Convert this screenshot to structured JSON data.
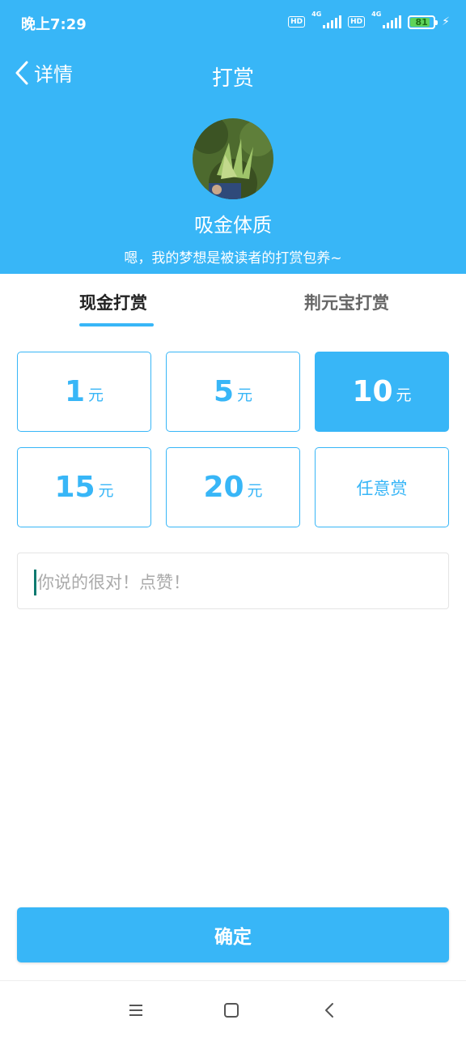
{
  "status_bar": {
    "time": "晚上7:29",
    "network_badge": "HD",
    "network_type": "4G",
    "battery_level": "81",
    "icons": [
      "hd-icon",
      "signal-icon",
      "battery-icon",
      "charging-icon"
    ]
  },
  "nav": {
    "back_label": "详情",
    "title": "打赏"
  },
  "profile": {
    "author_name": "吸金体质",
    "motto": "嗯，我的梦想是被读者的打赏包养~"
  },
  "tabs": [
    {
      "label": "现金打赏",
      "active": true
    },
    {
      "label": "荆元宝打赏",
      "active": false
    }
  ],
  "amount_options": [
    {
      "amount": "1",
      "unit": "元",
      "selected": false
    },
    {
      "amount": "5",
      "unit": "元",
      "selected": false
    },
    {
      "amount": "10",
      "unit": "元",
      "selected": true
    },
    {
      "amount": "15",
      "unit": "元",
      "selected": false
    },
    {
      "amount": "20",
      "unit": "元",
      "selected": false
    }
  ],
  "custom_option_label": "任意赏",
  "message": {
    "value": "",
    "placeholder": "你说的很对！点赞！"
  },
  "confirm_label": "确定",
  "colors": {
    "accent": "#38b6f7",
    "text_dark": "#222222",
    "text_muted": "#666666",
    "placeholder": "#aaaaaa"
  }
}
